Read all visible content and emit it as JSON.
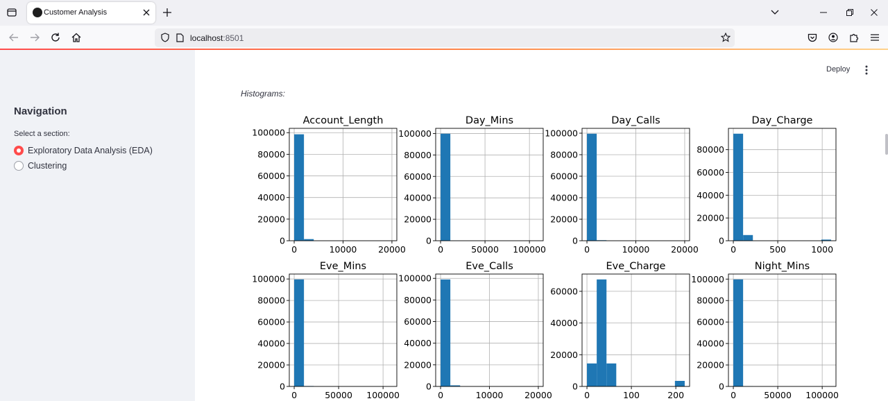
{
  "browser": {
    "tab_title": "Customer Analysis",
    "url_host": "localhost",
    "url_port": ":8501"
  },
  "sidebar": {
    "title": "Navigation",
    "select_label": "Select a section:",
    "options": [
      {
        "label": "Exploratory Data Analysis (EDA)",
        "selected": true
      },
      {
        "label": "Clustering",
        "selected": false
      }
    ]
  },
  "header": {
    "deploy_label": "Deploy"
  },
  "main": {
    "caption": "Histograms:"
  },
  "colors": {
    "accent": "#ff4b4b",
    "bar": "#1f77b4"
  },
  "chart_data": [
    {
      "type": "bar",
      "title": "Account_Length",
      "bins": [
        0,
        2000,
        4000,
        6000,
        8000,
        10000,
        12000,
        14000,
        16000,
        18000,
        20000
      ],
      "values": [
        98500,
        1500,
        0,
        0,
        0,
        0,
        0,
        0,
        0,
        0
      ],
      "xlim": [
        -1000,
        21000
      ],
      "ylim": [
        0,
        104000
      ],
      "xticks": [
        0,
        10000,
        20000
      ],
      "yticks": [
        0,
        20000,
        40000,
        60000,
        80000,
        100000
      ],
      "grid": true
    },
    {
      "type": "bar",
      "title": "Day_Mins",
      "bins": [
        0,
        11000,
        22000,
        33000,
        44000,
        55000,
        66000,
        77000,
        88000,
        99000,
        110000
      ],
      "values": [
        99800,
        200,
        0,
        0,
        0,
        0,
        0,
        0,
        0,
        0
      ],
      "xlim": [
        -5500,
        115500
      ],
      "ylim": [
        0,
        104800
      ],
      "xticks": [
        0,
        50000,
        100000
      ],
      "yticks": [
        0,
        20000,
        40000,
        60000,
        80000,
        100000
      ],
      "grid": true
    },
    {
      "type": "bar",
      "title": "Day_Calls",
      "bins": [
        0,
        2000,
        4000,
        6000,
        8000,
        10000,
        12000,
        14000,
        16000,
        18000,
        20000
      ],
      "values": [
        99500,
        500,
        0,
        0,
        0,
        0,
        0,
        0,
        0,
        0
      ],
      "xlim": [
        -1000,
        21000
      ],
      "ylim": [
        0,
        104500
      ],
      "xticks": [
        0,
        10000,
        20000
      ],
      "yticks": [
        0,
        20000,
        40000,
        60000,
        80000,
        100000
      ],
      "grid": true
    },
    {
      "type": "bar",
      "title": "Day_Charge",
      "bins": [
        0,
        110,
        220,
        330,
        440,
        550,
        660,
        770,
        880,
        990,
        1100
      ],
      "values": [
        94000,
        5000,
        0,
        0,
        0,
        0,
        0,
        0,
        0,
        1000
      ],
      "xlim": [
        -55,
        1155
      ],
      "ylim": [
        0,
        98700
      ],
      "xticks": [
        0,
        500,
        1000
      ],
      "yticks": [
        0,
        20000,
        40000,
        60000,
        80000
      ],
      "grid": true
    },
    {
      "type": "bar",
      "title": "Eve_Mins",
      "bins": [
        0,
        11000,
        22000,
        33000,
        44000,
        55000,
        66000,
        77000,
        88000,
        99000,
        110000
      ],
      "values": [
        99600,
        400,
        0,
        0,
        0,
        0,
        0,
        0,
        0,
        0
      ],
      "xlim": [
        -5500,
        115500
      ],
      "ylim": [
        0,
        104600
      ],
      "xticks": [
        0,
        50000,
        100000
      ],
      "yticks": [
        0,
        20000,
        40000,
        60000,
        80000,
        100000
      ],
      "grid": true
    },
    {
      "type": "bar",
      "title": "Eve_Calls",
      "bins": [
        0,
        2000,
        4000,
        6000,
        8000,
        10000,
        12000,
        14000,
        16000,
        18000,
        20000
      ],
      "values": [
        99000,
        1000,
        0,
        0,
        0,
        0,
        0,
        0,
        0,
        0
      ],
      "xlim": [
        -1000,
        21000
      ],
      "ylim": [
        0,
        104000
      ],
      "xticks": [
        0,
        10000,
        20000
      ],
      "yticks": [
        0,
        20000,
        40000,
        60000,
        80000,
        100000
      ],
      "grid": true
    },
    {
      "type": "bar",
      "title": "Eve_Charge",
      "bins": [
        0,
        22,
        44,
        66,
        88,
        110,
        132,
        154,
        176,
        198,
        220
      ],
      "values": [
        14500,
        67500,
        14500,
        0,
        0,
        0,
        0,
        0,
        0,
        3500
      ],
      "xlim": [
        -11,
        231
      ],
      "ylim": [
        0,
        70900
      ],
      "xticks": [
        0,
        100,
        200
      ],
      "yticks": [
        0,
        20000,
        40000,
        60000
      ],
      "grid": true
    },
    {
      "type": "bar",
      "title": "Night_Mins",
      "bins": [
        0,
        11000,
        22000,
        33000,
        44000,
        55000,
        66000,
        77000,
        88000,
        99000,
        110000
      ],
      "values": [
        99700,
        300,
        0,
        0,
        0,
        0,
        0,
        0,
        0,
        0
      ],
      "xlim": [
        -5500,
        115500
      ],
      "ylim": [
        0,
        104700
      ],
      "xticks": [
        0,
        50000,
        100000
      ],
      "yticks": [
        0,
        20000,
        40000,
        60000,
        80000,
        100000
      ],
      "grid": true
    }
  ]
}
